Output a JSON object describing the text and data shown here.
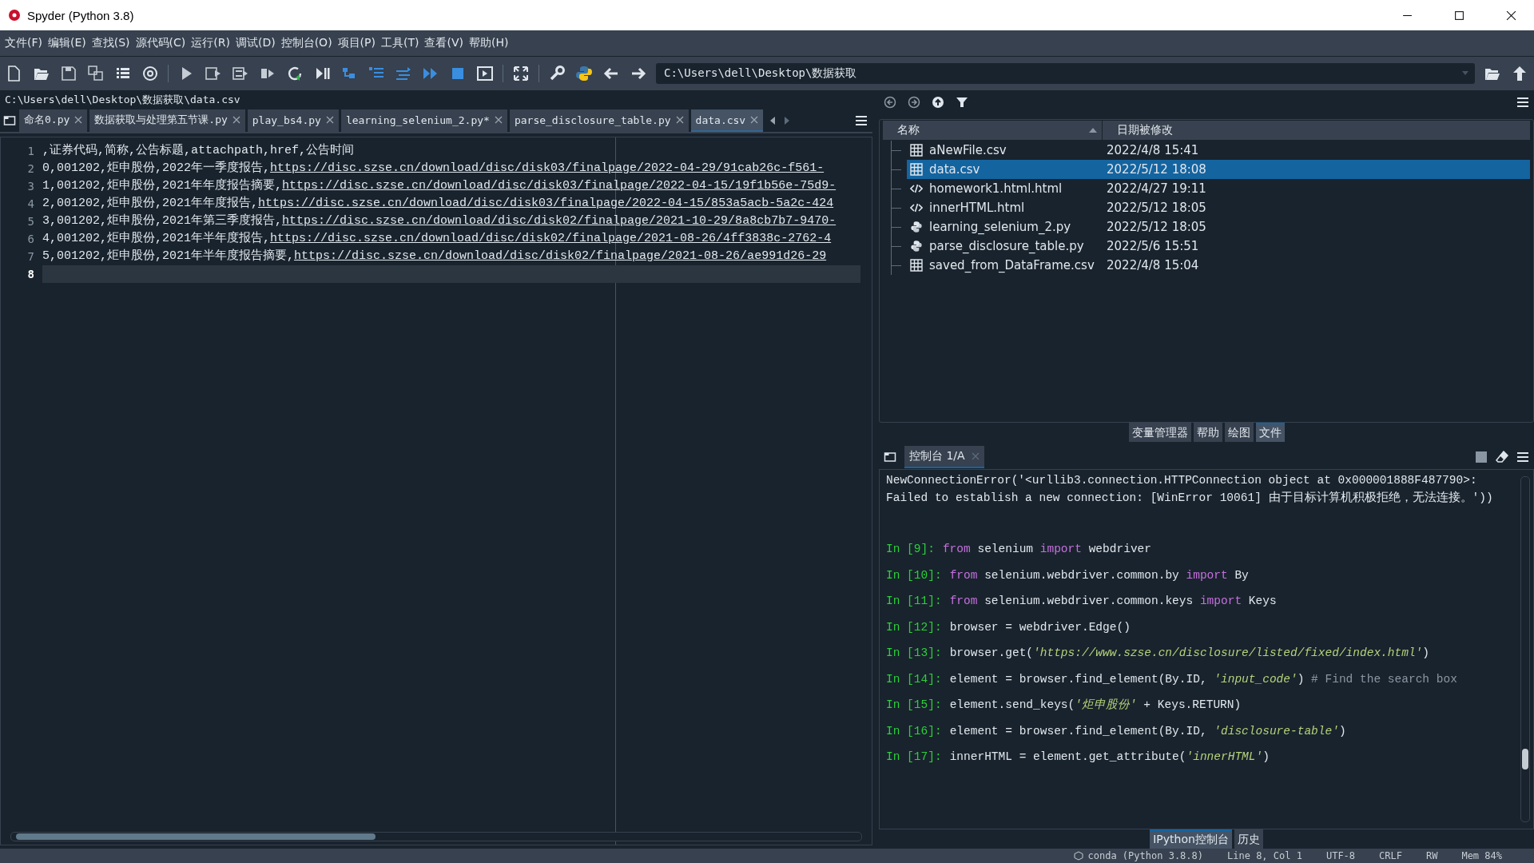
{
  "window": {
    "title": "Spyder (Python 3.8)"
  },
  "menu": [
    "文件(F)",
    "编辑(E)",
    "查找(S)",
    "源代码(C)",
    "运行(R)",
    "调试(D)",
    "控制台(O)",
    "项目(P)",
    "工具(T)",
    "查看(V)",
    "帮助(H)"
  ],
  "toolbar": {
    "working_directory": "C:\\Users\\dell\\Desktop\\数据获取"
  },
  "editor": {
    "file_path": "C:\\Users\\dell\\Desktop\\数据获取\\data.csv",
    "tabs": [
      {
        "label": "命名0.py",
        "selected": false
      },
      {
        "label": "数据获取与处理第五节课.py",
        "selected": false
      },
      {
        "label": "play_bs4.py",
        "selected": false
      },
      {
        "label": "learning_selenium_2.py*",
        "selected": false
      },
      {
        "label": "parse_disclosure_table.py",
        "selected": false
      },
      {
        "label": "data.csv",
        "selected": true
      }
    ],
    "lines": [
      {
        "number": "1",
        "text": ",证券代码,简称,公告标题,attachpath,href,公告时间",
        "current": false
      },
      {
        "number": "2",
        "text": "0,001202,炬申股份,2022年一季度报告,",
        "link": "https://disc.szse.cn/download/disc/disk03/finalpage/2022-04-29/91cab26c-f561-",
        "current": false
      },
      {
        "number": "3",
        "text": "1,001202,炬申股份,2021年年度报告摘要,",
        "link": "https://disc.szse.cn/download/disc/disk03/finalpage/2022-04-15/19f1b56e-75d9-",
        "current": false
      },
      {
        "number": "4",
        "text": "2,001202,炬申股份,2021年年度报告,",
        "link": "https://disc.szse.cn/download/disc/disk03/finalpage/2022-04-15/853a5acb-5a2c-424",
        "current": false
      },
      {
        "number": "5",
        "text": "3,001202,炬申股份,2021年第三季度报告,",
        "link": "https://disc.szse.cn/download/disc/disk02/finalpage/2021-10-29/8a8cb7b7-9470-",
        "current": false
      },
      {
        "number": "6",
        "text": "4,001202,炬申股份,2021年半年度报告,",
        "link": "https://disc.szse.cn/download/disc/disk02/finalpage/2021-08-26/4ff3838c-2762-4",
        "current": false
      },
      {
        "number": "7",
        "text": "5,001202,炬申股份,2021年半年度报告摘要,",
        "link": "https://disc.szse.cn/download/disc/disk02/finalpage/2021-08-26/ae991d26-29",
        "current": false
      },
      {
        "number": "8",
        "current": true
      }
    ]
  },
  "files": {
    "columns": [
      "名称",
      "日期被修改"
    ],
    "rows": [
      {
        "name": "aNewFile.csv",
        "modified": "2022/4/8 15:41",
        "kind": "table",
        "selected": false
      },
      {
        "name": "data.csv",
        "modified": "2022/5/12 18:08",
        "kind": "table",
        "selected": true
      },
      {
        "name": "homework1.html.html",
        "modified": "2022/4/27 19:11",
        "kind": "code",
        "selected": false
      },
      {
        "name": "innerHTML.html",
        "modified": "2022/5/12 18:05",
        "kind": "code",
        "selected": false
      },
      {
        "name": "learning_selenium_2.py",
        "modified": "2022/5/12 18:05",
        "kind": "python",
        "selected": false
      },
      {
        "name": "parse_disclosure_table.py",
        "modified": "2022/5/6 15:51",
        "kind": "python",
        "selected": false
      },
      {
        "name": "saved_from_DataFrame.csv",
        "modified": "2022/4/8 15:04",
        "kind": "table",
        "selected": false
      }
    ]
  },
  "pane_tabs": [
    {
      "label": "变量管理器",
      "selected": false
    },
    {
      "label": "帮助",
      "selected": false
    },
    {
      "label": "绘图",
      "selected": false
    },
    {
      "label": "文件",
      "selected": true
    }
  ],
  "console": {
    "tab": "控制台 1/A",
    "entries": [
      {
        "kind": "output",
        "text": "NewConnectionError('<urllib3.connection.HTTPConnection object at 0x000001888F487790>: Failed to establish a new connection: [WinError 10061] 由于目标计算机积极拒绝，无法连接。'))"
      },
      {
        "kind": "input",
        "prompt": "In [9]:",
        "tokens": [
          {
            "kind": "keyword",
            "text": "from"
          },
          {
            "kind": "plain",
            "text": " selenium "
          },
          {
            "kind": "keyword",
            "text": "import"
          },
          {
            "kind": "plain",
            "text": " webdriver"
          }
        ]
      },
      {
        "kind": "input",
        "prompt": "In [10]:",
        "tokens": [
          {
            "kind": "keyword",
            "text": "from"
          },
          {
            "kind": "plain",
            "text": " selenium.webdriver.common.by "
          },
          {
            "kind": "keyword",
            "text": "import"
          },
          {
            "kind": "plain",
            "text": " By"
          }
        ]
      },
      {
        "kind": "input",
        "prompt": "In [11]:",
        "tokens": [
          {
            "kind": "keyword",
            "text": "from"
          },
          {
            "kind": "plain",
            "text": " selenium.webdriver.common.keys "
          },
          {
            "kind": "keyword",
            "text": "import"
          },
          {
            "kind": "plain",
            "text": " Keys"
          }
        ]
      },
      {
        "kind": "input",
        "prompt": "In [12]:",
        "tokens": [
          {
            "kind": "plain",
            "text": "browser = webdriver.Edge()"
          }
        ]
      },
      {
        "kind": "input",
        "prompt": "In [13]:",
        "tokens": [
          {
            "kind": "plain",
            "text": "browser.get("
          },
          {
            "kind": "string",
            "text": "'https://www.szse.cn/disclosure/listed/fixed/index.html'"
          },
          {
            "kind": "plain",
            "text": ")"
          }
        ]
      },
      {
        "kind": "input",
        "prompt": "In [14]:",
        "tokens": [
          {
            "kind": "plain",
            "text": "element = browser.find_element(By.ID, "
          },
          {
            "kind": "string",
            "text": "'input_code'"
          },
          {
            "kind": "plain",
            "text": ")  "
          },
          {
            "kind": "comment",
            "text": "# Find the search box"
          }
        ]
      },
      {
        "kind": "input",
        "prompt": "In [15]:",
        "tokens": [
          {
            "kind": "plain",
            "text": "element.send_keys("
          },
          {
            "kind": "string",
            "text": "'炬申股份'"
          },
          {
            "kind": "plain",
            "text": " + Keys.RETURN)"
          }
        ]
      },
      {
        "kind": "input",
        "prompt": "In [16]:",
        "tokens": [
          {
            "kind": "plain",
            "text": "element = browser.find_element(By.ID, "
          },
          {
            "kind": "string",
            "text": "'disclosure-table'"
          },
          {
            "kind": "plain",
            "text": ")"
          }
        ]
      },
      {
        "kind": "input",
        "prompt": "In [17]:",
        "tokens": [
          {
            "kind": "plain",
            "text": "innerHTML = element.get_attribute("
          },
          {
            "kind": "string",
            "text": "'innerHTML'"
          },
          {
            "kind": "plain",
            "text": ")"
          }
        ]
      }
    ]
  },
  "console_tabs": [
    {
      "label": "IPython控制台",
      "selected": true
    },
    {
      "label": "历史",
      "selected": false
    }
  ],
  "status_bar": {
    "environment": "conda (Python 3.8.8)",
    "position": "Line 8, Col 1",
    "encoding": "UTF-8",
    "line_endings": "CRLF",
    "permissions": "RW",
    "memory": "Mem 84%"
  }
}
